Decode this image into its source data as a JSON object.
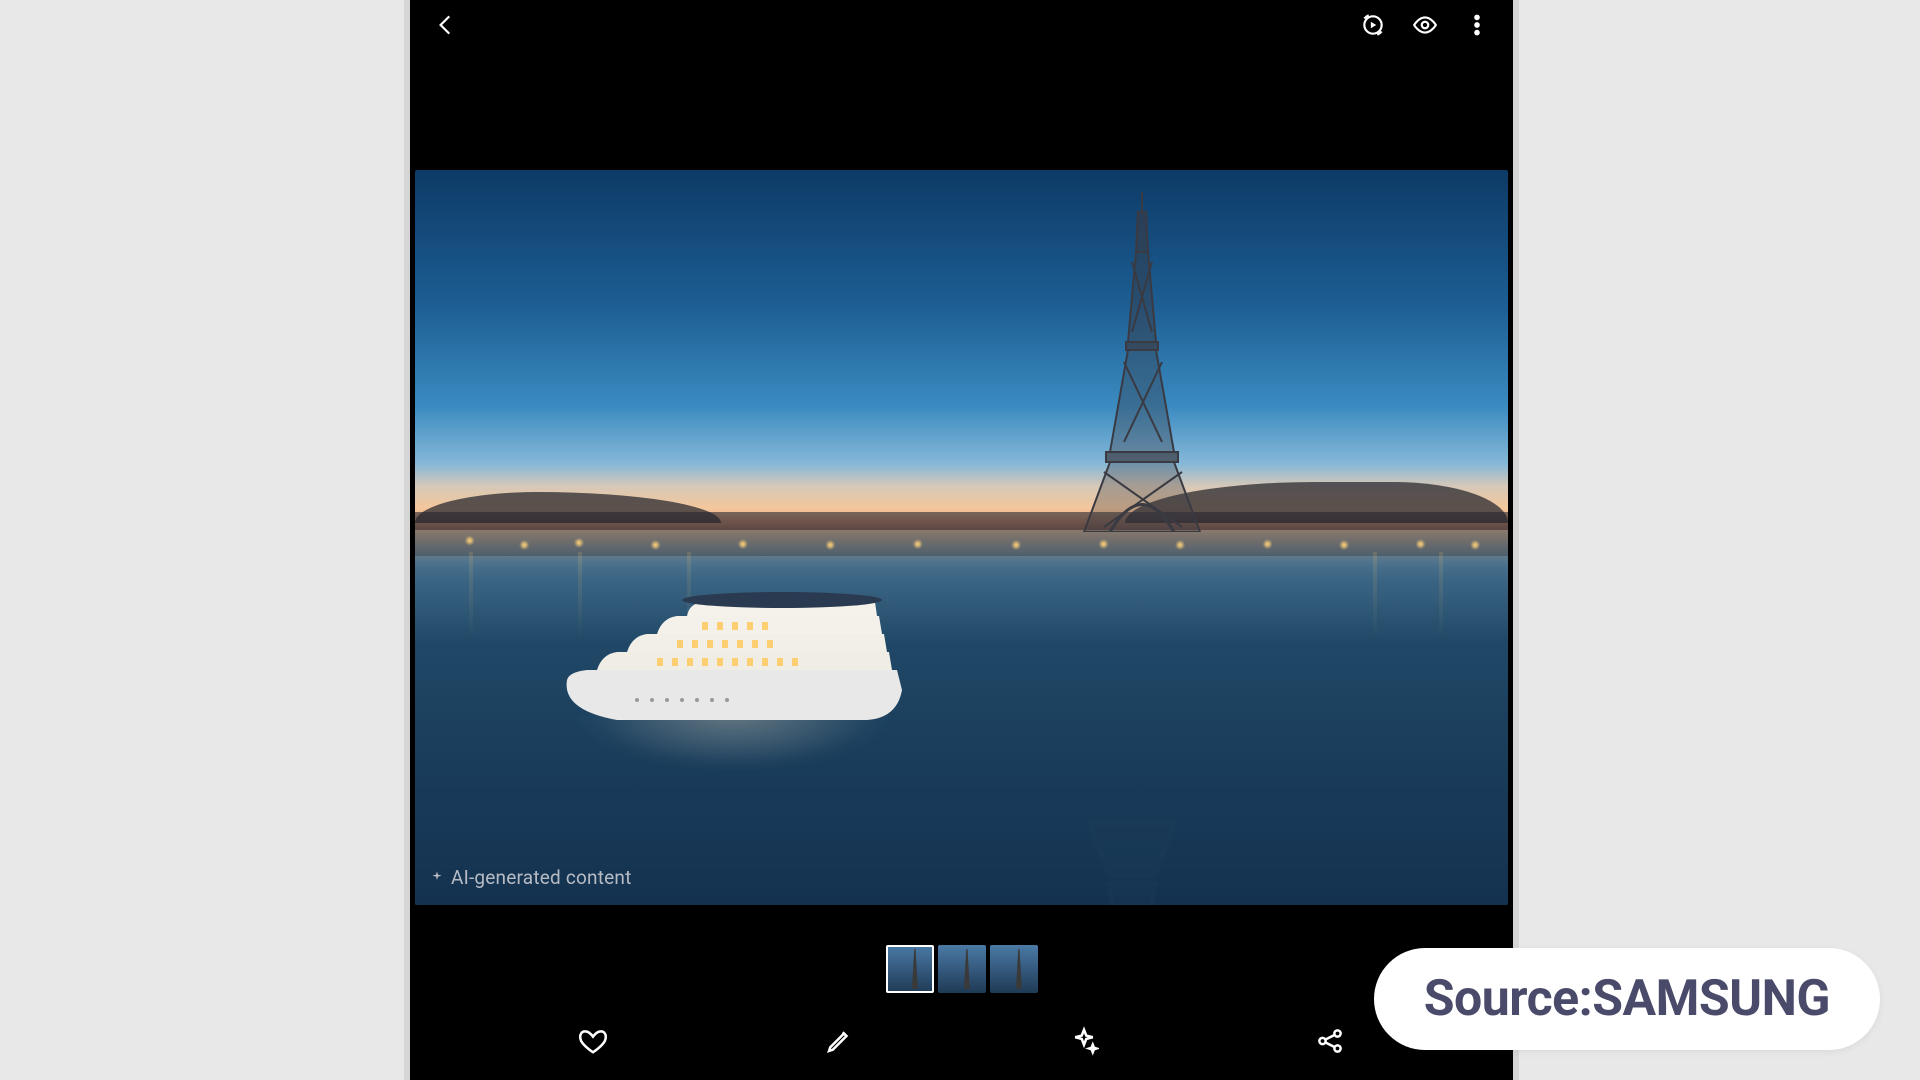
{
  "topbar": {
    "back": "Back",
    "remaster": "Remaster",
    "visibility": "Visibility",
    "more": "More options"
  },
  "image": {
    "watermark_label": "AI-generated content"
  },
  "thumbs": {
    "count": 3,
    "active_index": 0
  },
  "bottombar": {
    "favorite": "Favorite",
    "edit": "Edit",
    "ai": "AI tools",
    "share": "Share"
  },
  "overlay": {
    "source_label": "Source:SAMSUNG"
  }
}
